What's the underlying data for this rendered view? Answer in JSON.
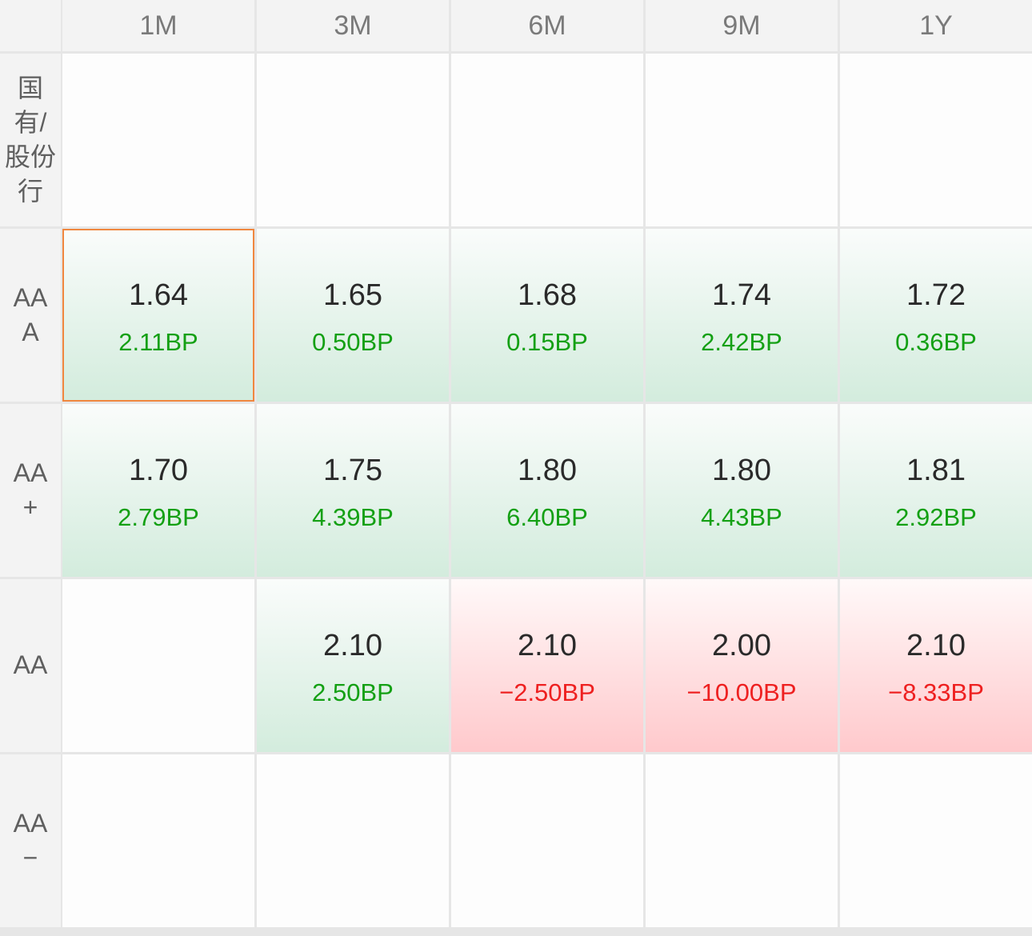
{
  "columns": [
    "1M",
    "3M",
    "6M",
    "9M",
    "1Y"
  ],
  "rows": [
    {
      "label": "国\n有/\n股份\n行",
      "cells": [
        null,
        null,
        null,
        null,
        null
      ]
    },
    {
      "label": "AA\nA",
      "cells": [
        {
          "rate": "1.64",
          "change": "2.11BP",
          "dir": "up",
          "selected": true
        },
        {
          "rate": "1.65",
          "change": "0.50BP",
          "dir": "up"
        },
        {
          "rate": "1.68",
          "change": "0.15BP",
          "dir": "up"
        },
        {
          "rate": "1.74",
          "change": "2.42BP",
          "dir": "up"
        },
        {
          "rate": "1.72",
          "change": "0.36BP",
          "dir": "up"
        }
      ]
    },
    {
      "label": "AA\n+",
      "cells": [
        {
          "rate": "1.70",
          "change": "2.79BP",
          "dir": "up"
        },
        {
          "rate": "1.75",
          "change": "4.39BP",
          "dir": "up"
        },
        {
          "rate": "1.80",
          "change": "6.40BP",
          "dir": "up"
        },
        {
          "rate": "1.80",
          "change": "4.43BP",
          "dir": "up"
        },
        {
          "rate": "1.81",
          "change": "2.92BP",
          "dir": "up"
        }
      ]
    },
    {
      "label": "AA",
      "cells": [
        null,
        {
          "rate": "2.10",
          "change": "2.50BP",
          "dir": "up"
        },
        {
          "rate": "2.10",
          "change": "−2.50BP",
          "dir": "down"
        },
        {
          "rate": "2.00",
          "change": "−10.00BP",
          "dir": "down"
        },
        {
          "rate": "2.10",
          "change": "−8.33BP",
          "dir": "down"
        }
      ]
    },
    {
      "label": "AA\n−",
      "cells": [
        null,
        null,
        null,
        null,
        null
      ]
    }
  ],
  "colors": {
    "up": "#14a014",
    "down": "#ee2020",
    "selected_border": "#f0873f"
  }
}
